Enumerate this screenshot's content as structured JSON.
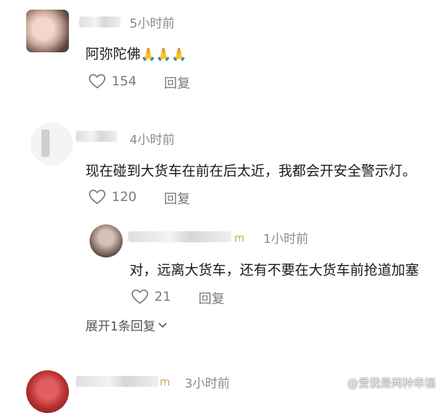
{
  "comments": [
    {
      "time": "5小时前",
      "text": "阿弥陀佛",
      "emoji": "🙏🙏🙏",
      "likes": "154",
      "reply_label": "回复"
    },
    {
      "time": "4小时前",
      "text": "现在碰到大货车在前在后太近，我都会开安全警示灯。",
      "likes": "120",
      "reply_label": "回复",
      "reply": {
        "time": "1小时前",
        "text": "对，远离大货车，还有不要在大货车前抢道加塞",
        "likes": "21",
        "reply_label": "回复"
      },
      "expand_label": "展开1条回复"
    },
    {
      "time": "3小时前"
    }
  ],
  "watermark": "@爱我是两种幸福",
  "colors": {
    "text": "#1a1a1a",
    "meta": "#8a8a8a",
    "icon": "#7a7a7a"
  }
}
